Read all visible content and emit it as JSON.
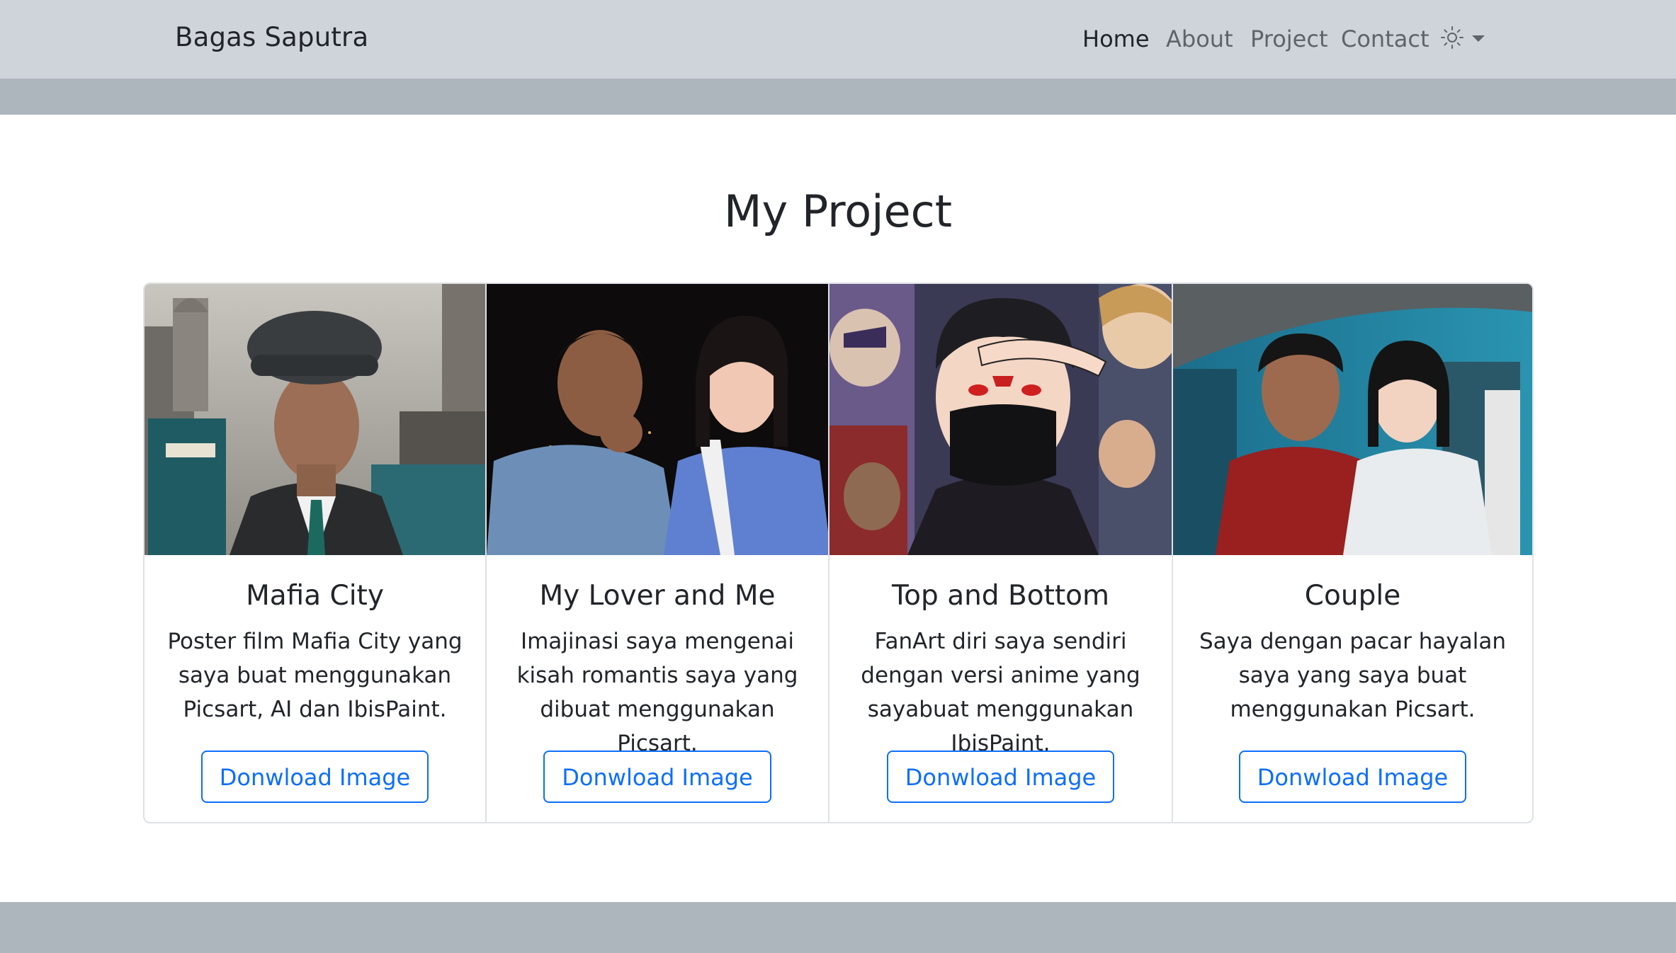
{
  "navbar": {
    "brand": "Bagas Saputra",
    "links": [
      {
        "label": "Home",
        "active": true
      },
      {
        "label": "About",
        "active": false
      },
      {
        "label": "Project",
        "active": false
      },
      {
        "label": "Contact",
        "active": false
      }
    ],
    "theme_icon": "sun-icon",
    "dropdown_icon": "caret-down-icon"
  },
  "main": {
    "title": "My Project",
    "cards": [
      {
        "title": "Mafia City",
        "text": "Poster film Mafia City yang saya buat menggunakan Picsart, AI dan IbisPaint.",
        "button": "Donwload Image"
      },
      {
        "title": "My Lover and Me",
        "text": "Imajinasi saya mengenai kisah romantis saya yang dibuat menggunakan Picsart.",
        "button": "Donwload Image"
      },
      {
        "title": "Top and Bottom",
        "text": "FanArt diri saya sendiri dengan versi anime yang sayabuat menggunakan IbisPaint.",
        "button": "Donwload Image"
      },
      {
        "title": "Couple",
        "text": "Saya dengan pacar hayalan saya yang saya buat menggunakan Picsart.",
        "button": "Donwload Image"
      }
    ]
  },
  "colors": {
    "navbar_bg": "#cfd4da",
    "band": "#adb5bd",
    "primary": "#0d6efd"
  }
}
